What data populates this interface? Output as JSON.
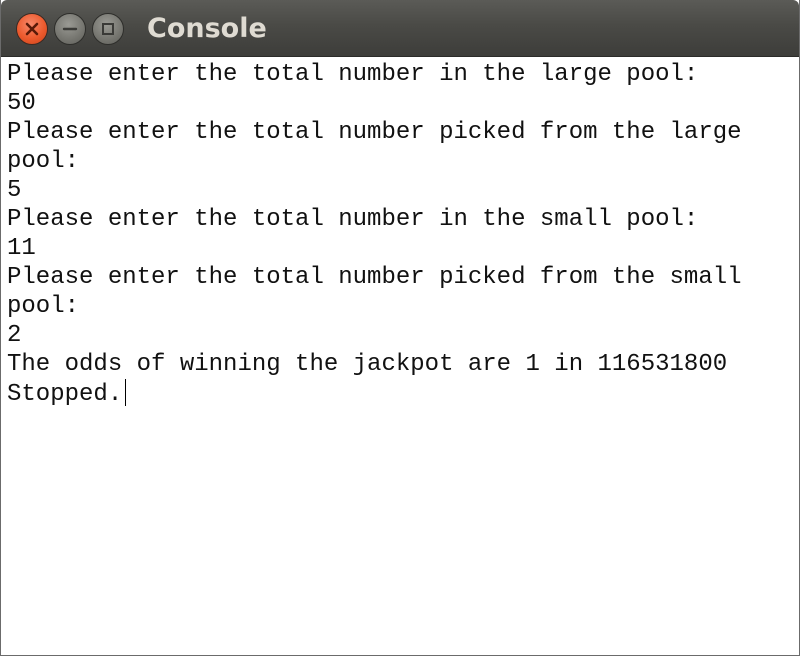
{
  "window": {
    "title": "Console",
    "buttons": {
      "close_icon": "close-icon",
      "minimize_icon": "minimize-icon",
      "maximize_icon": "maximize-icon"
    }
  },
  "console": {
    "lines": [
      "Please enter the total number in the large pool:",
      "50",
      "Please enter the total number picked from the large",
      "pool:",
      "5",
      "Please enter the total number in the small pool:",
      "11",
      "Please enter the total number picked from the small",
      "pool:",
      "2",
      "The odds of winning the jackpot are 1 in 116531800",
      "Stopped."
    ]
  },
  "colors": {
    "titlebar": "#4a4a46",
    "title_text": "#dfdbd2",
    "close_button": "#ec5a2d",
    "console_background": "#ffffff",
    "console_text": "#111111"
  }
}
